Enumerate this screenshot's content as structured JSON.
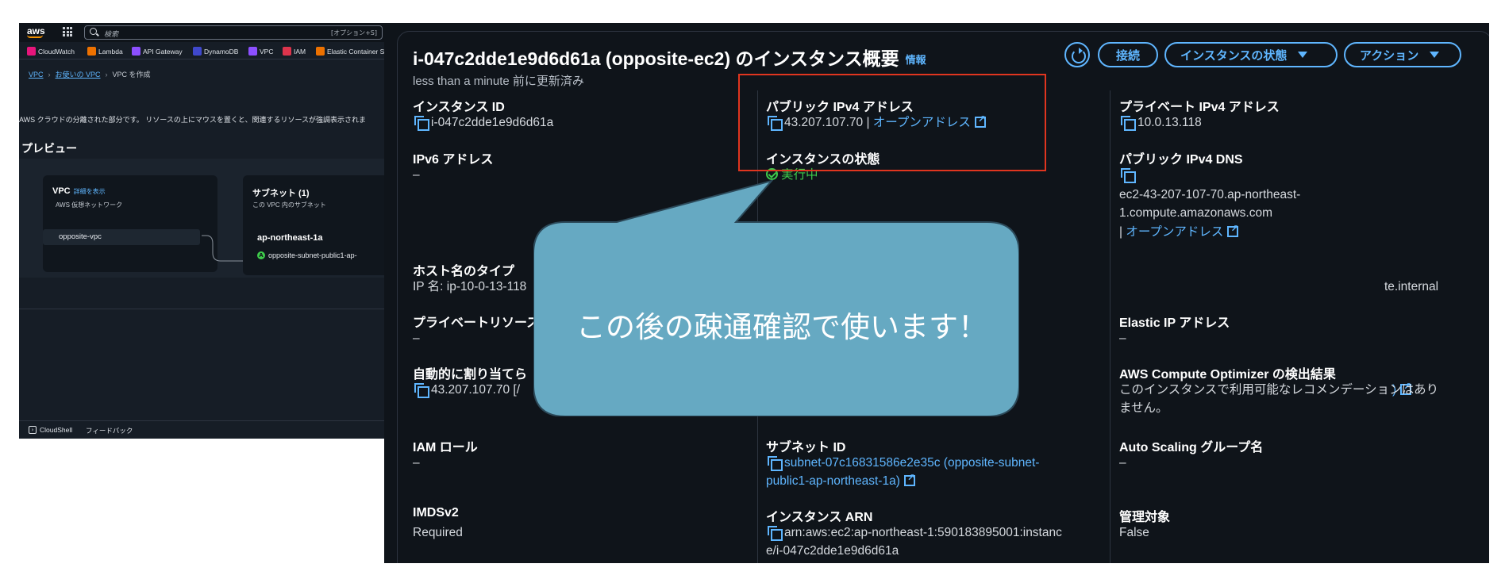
{
  "left_console": {
    "logo": "aws",
    "search": {
      "placeholder": "検索",
      "shortcut": "[オプション+S]"
    },
    "favorites": [
      {
        "label": "CloudWatch",
        "color": "#e7157b"
      },
      {
        "label": "Lambda",
        "color": "#ed7100"
      },
      {
        "label": "API Gateway",
        "color": "#8c4fff"
      },
      {
        "label": "DynamoDB",
        "color": "#3f48cc"
      },
      {
        "label": "VPC",
        "color": "#8c4fff"
      },
      {
        "label": "IAM",
        "color": "#dd344c"
      },
      {
        "label": "Elastic Container S",
        "color": "#ed7100"
      }
    ],
    "breadcrumb": {
      "item1": "VPC",
      "item2": "お使いの VPC",
      "current": "VPC を作成"
    },
    "description": "AWS クラウドの分離された部分です。 リソースの上にマウスを置くと、関連するリソースが強調表示されま",
    "preview_title": "プレビュー",
    "vpc_card": {
      "title": "VPC",
      "link": "詳細を表示",
      "subtitle": "AWS 仮想ネットワーク",
      "item": "opposite-vpc"
    },
    "subnet_card": {
      "title": "サブネット (1)",
      "subtitle": "この VPC 内のサブネット",
      "az": "ap-northeast-1a",
      "subnet": "opposite-subnet-public1-ap-",
      "badge": "A"
    },
    "footer": {
      "cloudshell": "CloudShell",
      "feedback": "フィードバック"
    }
  },
  "instance": {
    "title": "i-047c2dde1e9d6d61a (opposite-ec2) のインスタンス概要",
    "info": "情報",
    "updated": "less than a minute 前に更新済み",
    "buttons": {
      "connect": "接続",
      "state": "インスタンスの状態",
      "actions": "アクション"
    },
    "fields": {
      "instance_id_label": "インスタンス ID",
      "instance_id": "i-047c2dde1e9d6d61a",
      "public_ipv4_label": "パブリック IPv4 アドレス",
      "public_ipv4": "43.207.107.70",
      "open_address": "オープンアドレス",
      "private_ipv4_label": "プライベート IPv4 アドレス",
      "private_ipv4": "10.0.13.118",
      "ipv6_label": "IPv6 アドレス",
      "ipv6": "–",
      "state_label": "インスタンスの状態",
      "state": "実行中",
      "public_dns_label": "パブリック IPv4 DNS",
      "public_dns_line1": "ec2-43-207-107-70.ap-northeast-",
      "public_dns_line2": "1.compute.amazonaws.com",
      "pipe": "|",
      "hostname_type_label": "ホスト名のタイプ",
      "hostname_type": "IP 名: ip-10-0-13-118",
      "private_dns_tail": "te.internal",
      "private_resource_label": "プライベートリソース",
      "private_resource": "–",
      "elastic_ip_label": "Elastic IP アドレス",
      "elastic_ip": "–",
      "auto_ip_label": "自動的に割り当てら",
      "auto_ip": "43.207.107.70 [/",
      "vpc_tail": ")",
      "optimizer_label": "AWS Compute Optimizer の検出結果",
      "optimizer_line1": "このインスタンスで利用可能なレコメンデーションはあり",
      "optimizer_line2": "ません。",
      "iam_label": "IAM ロール",
      "iam": "–",
      "subnet_label": "サブネット ID",
      "subnet_line1": "subnet-07c16831586e2e35c (opposite-subnet-",
      "subnet_line2": "public1-ap-northeast-1a)",
      "asg_label": "Auto Scaling グループ名",
      "asg": "–",
      "imds_label": "IMDSv2",
      "imds": "Required",
      "arn_label": "インスタンス ARN",
      "arn_line1": "arn:aws:ec2:ap-northeast-1:590183895001:instanc",
      "arn_line2": "e/i-047c2dde1e9d6d61a",
      "managed_label": "管理対象",
      "managed": "False"
    }
  },
  "callout": {
    "text": "この後の疎通確認で使います！",
    "fill": "#66a9c2",
    "highlight_color": "#e0351f"
  }
}
